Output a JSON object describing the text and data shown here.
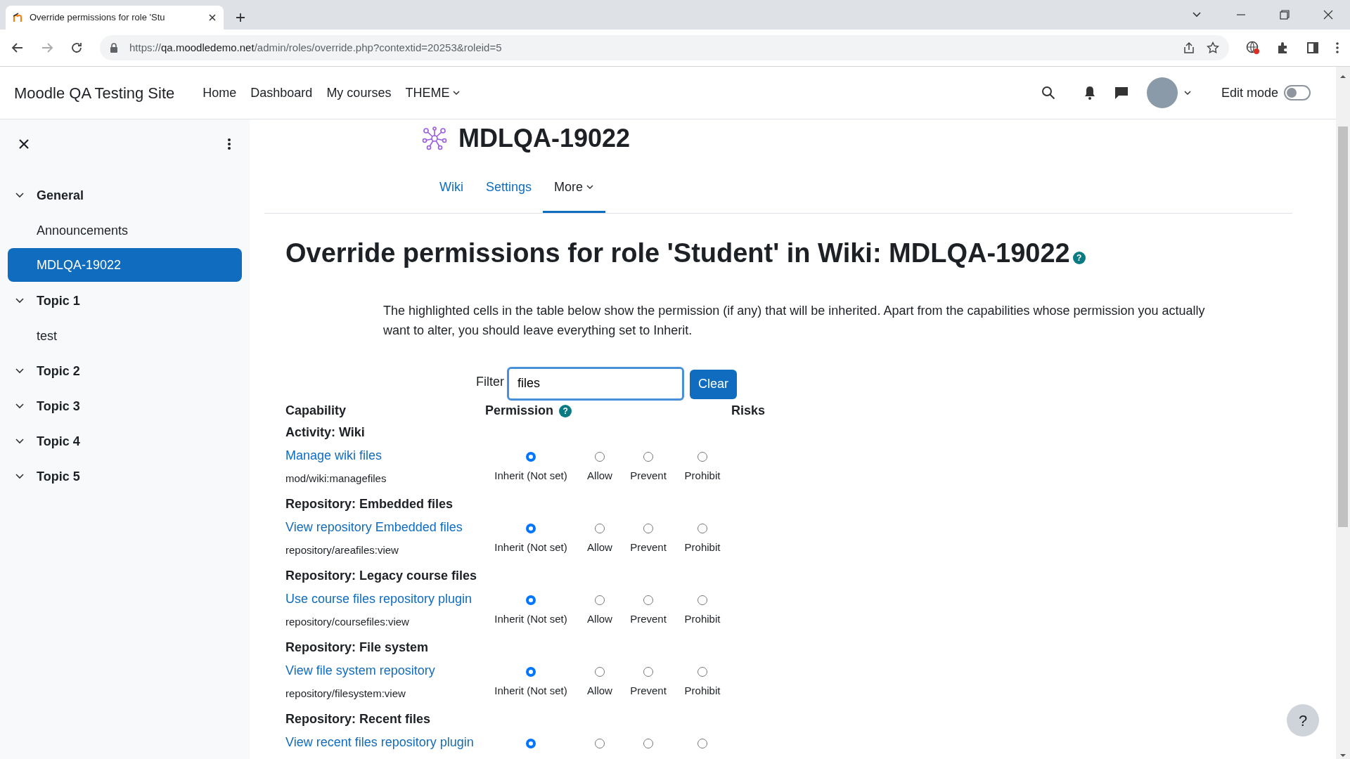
{
  "browser": {
    "tab_title": "Override permissions for role 'Stu",
    "url": {
      "scheme": "https://",
      "host": "qa.moodledemo.net",
      "path": "/admin/roles/override.php?contextid=20253&roleid=5"
    }
  },
  "navbar": {
    "site_name": "Moodle QA Testing Site",
    "items": [
      {
        "label": "Home",
        "dropdown": false
      },
      {
        "label": "Dashboard",
        "dropdown": false
      },
      {
        "label": "My courses",
        "dropdown": false
      },
      {
        "label": "THEME",
        "dropdown": true
      }
    ],
    "edit_mode": {
      "label": "Edit mode",
      "on": false
    }
  },
  "sidebar": {
    "items": [
      {
        "label": "General",
        "expanded": true,
        "children": [
          {
            "label": "Announcements",
            "selected": false
          },
          {
            "label": "MDLQA-19022",
            "selected": true
          }
        ]
      },
      {
        "label": "Topic 1",
        "expanded": true,
        "children": [
          {
            "label": "test",
            "selected": false
          }
        ]
      },
      {
        "label": "Topic 2",
        "expanded": true
      },
      {
        "label": "Topic 3",
        "expanded": true
      },
      {
        "label": "Topic 4",
        "expanded": true
      },
      {
        "label": "Topic 5",
        "expanded": true
      }
    ]
  },
  "page_header": {
    "title": "MDLQA-19022"
  },
  "secondary_nav": [
    {
      "label": "Wiki",
      "selected": false,
      "dropdown": false
    },
    {
      "label": "Settings",
      "selected": false,
      "dropdown": false
    },
    {
      "label": "More",
      "selected": true,
      "dropdown": true
    }
  ],
  "heading": {
    "text": "Override permissions for role 'Student' in Wiki: MDLQA-19022",
    "help": "?"
  },
  "intro": "The highlighted cells in the table below show the permission (if any) that will be inherited. Apart from the capabilities whose permission you actually want to alter, you should leave everything set to Inherit.",
  "filter": {
    "label": "Filter",
    "value": "files",
    "button": "Clear"
  },
  "table": {
    "columns": [
      {
        "label": "Capability"
      },
      {
        "label": "Permission",
        "help": "?"
      },
      {
        "label": "Risks"
      }
    ],
    "groups": [
      {
        "heading": "Activity: Wiki",
        "capabilities": [
          {
            "name": "Manage wiki files",
            "code": "mod/wiki:managefiles",
            "options": [
              {
                "label": "Inherit (Not set)",
                "selected": true
              },
              {
                "label": "Allow",
                "selected": false
              },
              {
                "label": "Prevent",
                "selected": false
              },
              {
                "label": "Prohibit",
                "selected": false
              }
            ]
          }
        ]
      },
      {
        "heading": "Repository: Embedded files",
        "capabilities": [
          {
            "name": "View repository Embedded files",
            "code": "repository/areafiles:view",
            "options": [
              {
                "label": "Inherit (Not set)",
                "selected": true
              },
              {
                "label": "Allow",
                "selected": false
              },
              {
                "label": "Prevent",
                "selected": false
              },
              {
                "label": "Prohibit",
                "selected": false
              }
            ]
          }
        ]
      },
      {
        "heading": "Repository: Legacy course files",
        "capabilities": [
          {
            "name": "Use course files repository plugin",
            "code": "repository/coursefiles:view",
            "options": [
              {
                "label": "Inherit (Not set)",
                "selected": true
              },
              {
                "label": "Allow",
                "selected": false
              },
              {
                "label": "Prevent",
                "selected": false
              },
              {
                "label": "Prohibit",
                "selected": false
              }
            ]
          }
        ]
      },
      {
        "heading": "Repository: File system",
        "capabilities": [
          {
            "name": "View file system repository",
            "code": "repository/filesystem:view",
            "options": [
              {
                "label": "Inherit (Not set)",
                "selected": true
              },
              {
                "label": "Allow",
                "selected": false
              },
              {
                "label": "Prevent",
                "selected": false
              },
              {
                "label": "Prohibit",
                "selected": false
              }
            ]
          }
        ]
      },
      {
        "heading": "Repository: Recent files",
        "capabilities": [
          {
            "name": "View recent files repository plugin",
            "options": [
              {
                "selected": true
              },
              {
                "selected": false
              },
              {
                "selected": false
              },
              {
                "selected": false
              }
            ]
          }
        ]
      }
    ]
  },
  "help_button": "?"
}
